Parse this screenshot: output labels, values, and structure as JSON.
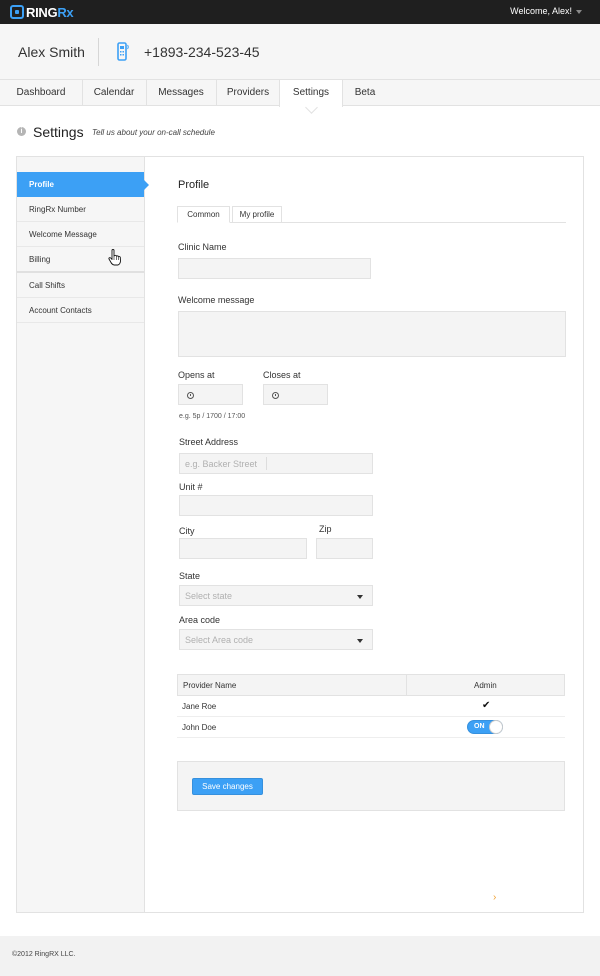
{
  "brand": {
    "logo_text_main": "RING",
    "logo_text_accent": "Rx"
  },
  "topbar": {
    "welcome": "Welcome, Alex!"
  },
  "header": {
    "user_name": "Alex Smith",
    "phone": "+1893-234-523-45"
  },
  "nav": {
    "tabs": [
      {
        "label": "Dashboard"
      },
      {
        "label": "Calendar"
      },
      {
        "label": "Messages"
      },
      {
        "label": "Providers"
      },
      {
        "label": "Settings",
        "active": true
      },
      {
        "label": "Beta"
      }
    ]
  },
  "page": {
    "title": "Settings",
    "subtitle": "Tell us about your on-call schedule",
    "info_glyph": "i"
  },
  "sidebar": {
    "items": [
      {
        "label": "Profile",
        "active": true
      },
      {
        "label": "RingRx Number"
      },
      {
        "label": "Welcome Message"
      },
      {
        "label": "Billing"
      },
      {
        "label": "Call Shifts"
      },
      {
        "label": "Account Contacts"
      }
    ]
  },
  "profile": {
    "title": "Profile",
    "subtabs": [
      {
        "label": "Common",
        "active": true
      },
      {
        "label": "My profile"
      }
    ],
    "clinic_name_label": "Clinic Name",
    "clinic_name_value": "",
    "welcome_message_label": "Welcome message",
    "welcome_message_value": "",
    "opens_at_label": "Opens at",
    "closes_at_label": "Closes at",
    "time_hint": "e.g. 5p / 1700 / 17:00",
    "street_label": "Street Address",
    "street_placeholder": "e.g. Backer Street",
    "unit_label": "Unit #",
    "city_label": "City",
    "zip_label": "Zip",
    "state_label": "State",
    "state_placeholder": "Select state",
    "area_code_label": "Area code",
    "area_code_placeholder": "Select Area code"
  },
  "providers_table": {
    "headers": {
      "name": "Provider Name",
      "admin": "Admin"
    },
    "rows": [
      {
        "name": "Jane Roe",
        "admin": "check",
        "check_glyph": "✔"
      },
      {
        "name": "John Doe",
        "admin": "toggle",
        "toggle_label": "ON"
      }
    ]
  },
  "actions": {
    "save_label": "Save changes",
    "next_glyph": "›"
  },
  "footer": {
    "copyright": "©2012 RingRX LLC."
  },
  "colors": {
    "accent": "#3ca0f5",
    "topbar": "#1f1f1f",
    "arrow": "#f0a030"
  },
  "icons": [
    "info-icon",
    "phone-icon",
    "clock-icon",
    "chevron-down-icon",
    "check-icon",
    "chevron-right-icon",
    "hand-cursor-icon"
  ]
}
